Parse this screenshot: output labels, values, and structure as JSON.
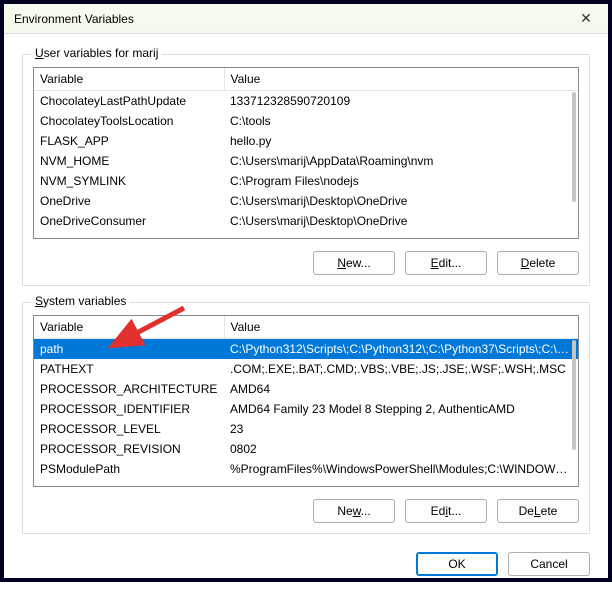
{
  "window": {
    "title": "Environment Variables",
    "close_glyph": "✕"
  },
  "user_group": {
    "label_prefix": "U",
    "label_rest": "ser variables for marij",
    "headers": {
      "variable": "Variable",
      "value": "Value"
    },
    "rows": [
      {
        "variable": "ChocolateyLastPathUpdate",
        "value": "133712328590720109"
      },
      {
        "variable": "ChocolateyToolsLocation",
        "value": "C:\\tools"
      },
      {
        "variable": "FLASK_APP",
        "value": "hello.py"
      },
      {
        "variable": "NVM_HOME",
        "value": "C:\\Users\\marij\\AppData\\Roaming\\nvm"
      },
      {
        "variable": "NVM_SYMLINK",
        "value": "C:\\Program Files\\nodejs"
      },
      {
        "variable": "OneDrive",
        "value": "C:\\Users\\marij\\Desktop\\OneDrive"
      },
      {
        "variable": "OneDriveConsumer",
        "value": "C:\\Users\\marij\\Desktop\\OneDrive"
      }
    ],
    "buttons": {
      "new_u": "N",
      "new_rest": "ew...",
      "edit_u": "E",
      "edit_rest": "dit...",
      "delete_u": "D",
      "delete_rest": "elete"
    }
  },
  "system_group": {
    "label_prefix": "S",
    "label_rest": "ystem variables",
    "headers": {
      "variable": "Variable",
      "value": "Value"
    },
    "rows": [
      {
        "variable": "path",
        "value": "C:\\Python312\\Scripts\\;C:\\Python312\\;C:\\Python37\\Scripts\\;C:\\Pyth...",
        "selected": true
      },
      {
        "variable": "PATHEXT",
        "value": ".COM;.EXE;.BAT;.CMD;.VBS;.VBE;.JS;.JSE;.WSF;.WSH;.MSC"
      },
      {
        "variable": "PROCESSOR_ARCHITECTURE",
        "value": "AMD64"
      },
      {
        "variable": "PROCESSOR_IDENTIFIER",
        "value": "AMD64 Family 23 Model 8 Stepping 2, AuthenticAMD"
      },
      {
        "variable": "PROCESSOR_LEVEL",
        "value": "23"
      },
      {
        "variable": "PROCESSOR_REVISION",
        "value": "0802"
      },
      {
        "variable": "PSModulePath",
        "value": "%ProgramFiles%\\WindowsPowerShell\\Modules;C:\\WINDOWS\\syst..."
      }
    ],
    "buttons": {
      "new_u": "w",
      "new_text": "Ne",
      "new_suffix": "...",
      "edit_u": "i",
      "edit_pre": "Ed",
      "edit_suffix": "t...",
      "delete_u": "L",
      "delete_pre": "De",
      "delete_suffix": "ete"
    }
  },
  "dialog": {
    "ok": "OK",
    "cancel": "Cancel"
  },
  "arrow_color": "#e03030"
}
